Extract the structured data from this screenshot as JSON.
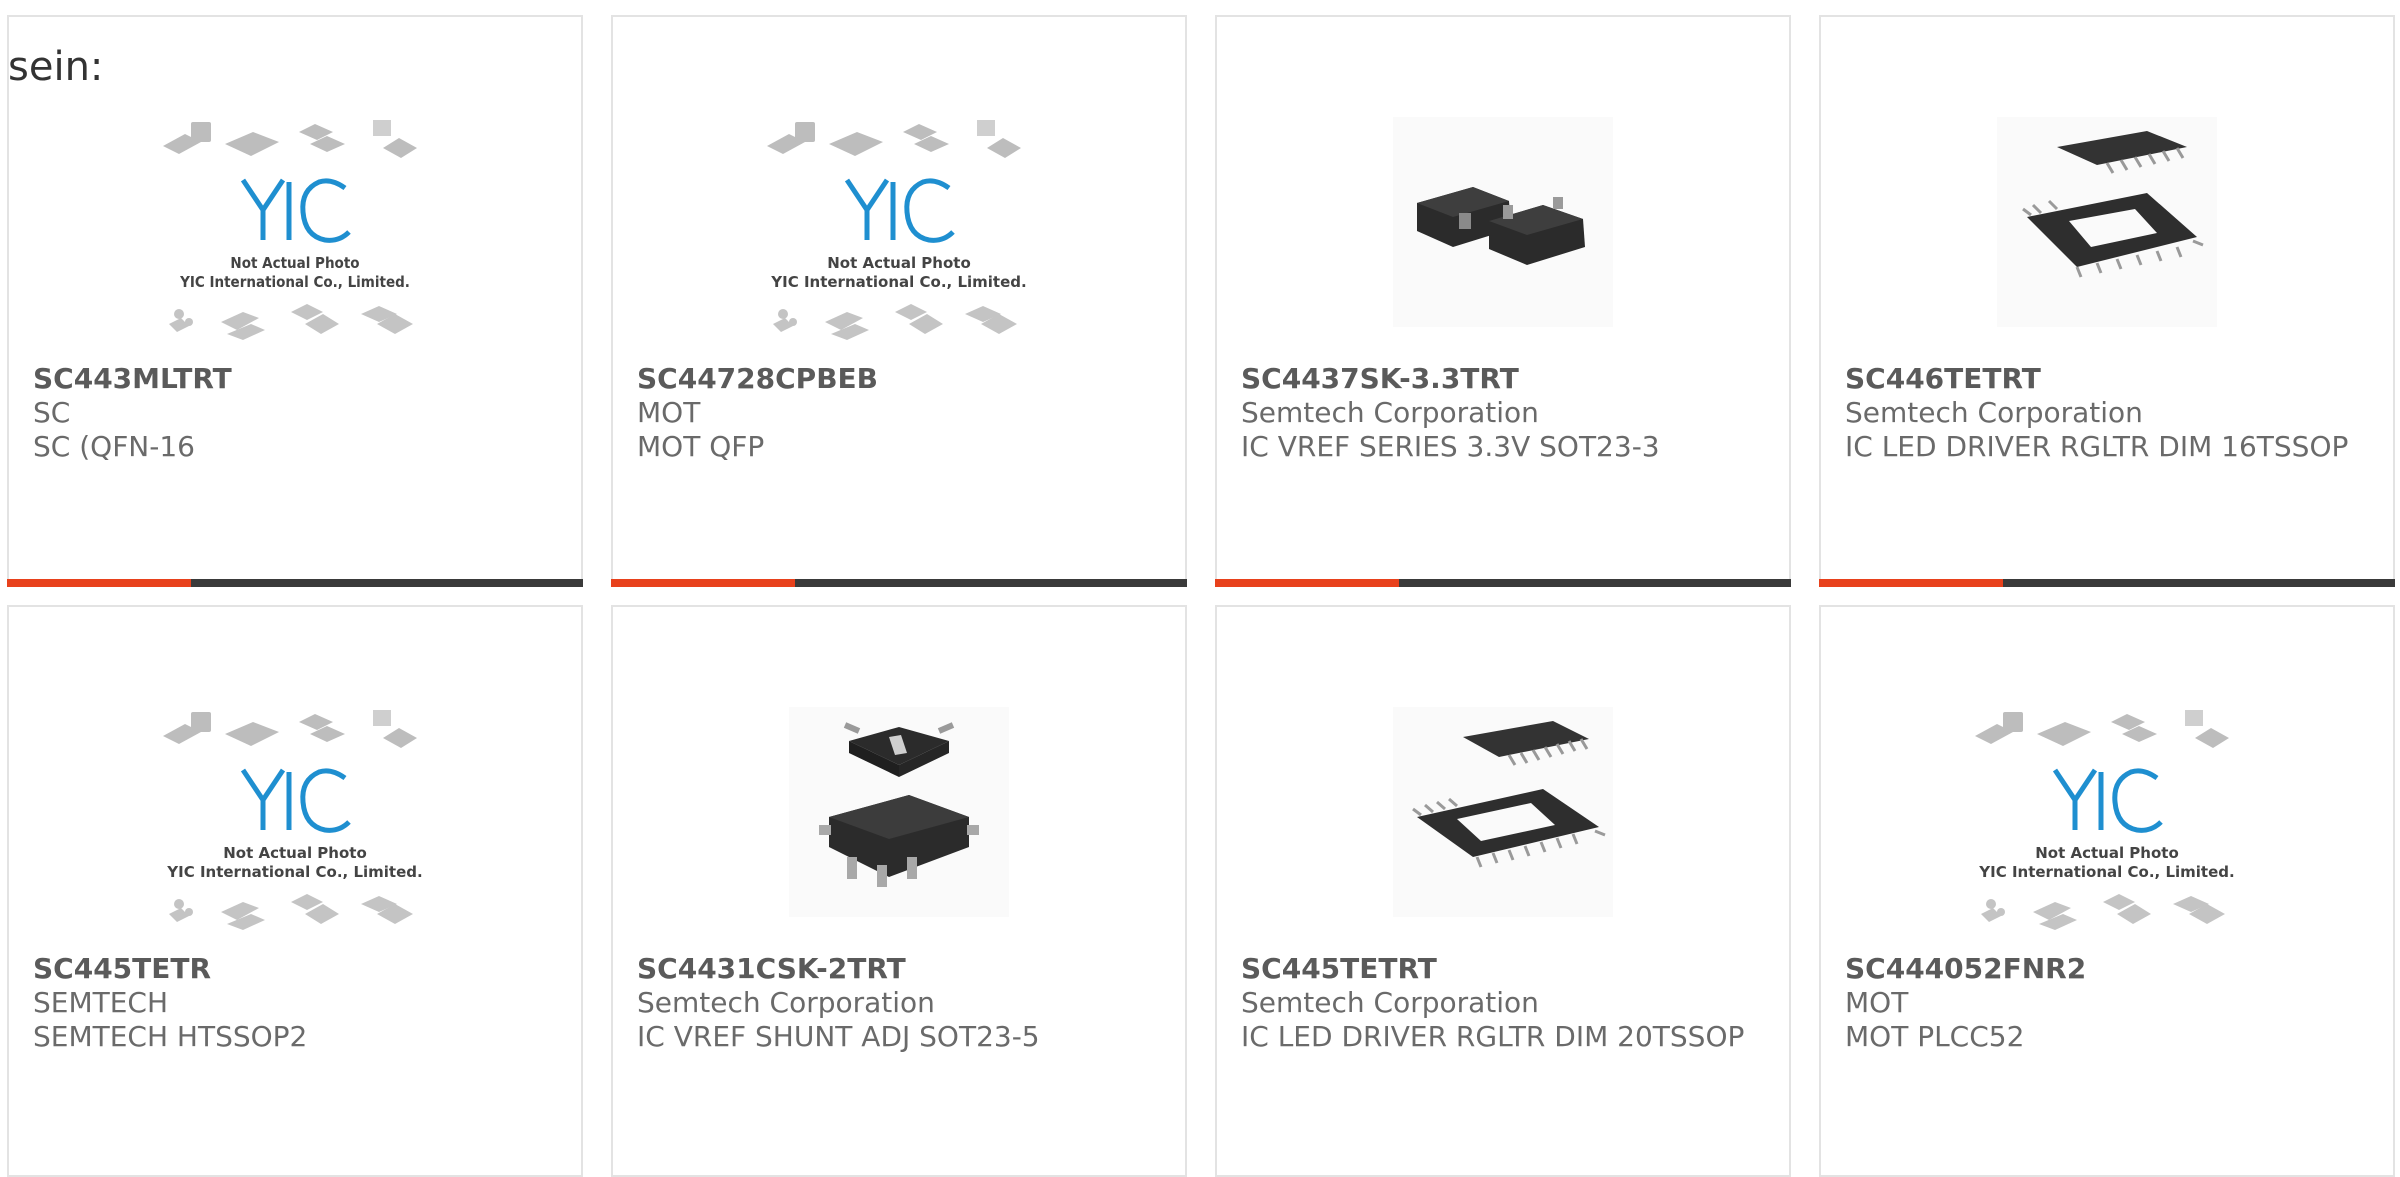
{
  "page": {
    "label": "sein:"
  },
  "products": [
    {
      "part_number": "SC443MLTRT",
      "manufacturer": "SC",
      "description": "SC (QFN-16",
      "image": "yic-placeholder"
    },
    {
      "part_number": "SC44728CPBEB",
      "manufacturer": "MOT",
      "description": "MOT QFP",
      "image": "yic-placeholder"
    },
    {
      "part_number": "SC4437SK-3.3TRT",
      "manufacturer": "Semtech Corporation",
      "description": "IC VREF SERIES 3.3V SOT23-3",
      "image": "sot23-3-package"
    },
    {
      "part_number": "SC446TETRT",
      "manufacturer": "Semtech Corporation",
      "description": "IC LED DRIVER RGLTR DIM 16TSSOP",
      "image": "tssop16-package"
    },
    {
      "part_number": "SC445TETR",
      "manufacturer": "SEMTECH",
      "description": "SEMTECH HTSSOP2",
      "image": "yic-placeholder"
    },
    {
      "part_number": "SC4431CSK-2TRT",
      "manufacturer": "Semtech Corporation",
      "description": "IC VREF SHUNT ADJ SOT23-5",
      "image": "sot23-5-package"
    },
    {
      "part_number": "SC445TETRT",
      "manufacturer": "Semtech Corporation",
      "description": "IC LED DRIVER RGLTR DIM 20TSSOP",
      "image": "tssop20-package"
    },
    {
      "part_number": "SC444052FNR2",
      "manufacturer": "MOT",
      "description": "MOT PLCC52",
      "image": "yic-placeholder"
    }
  ],
  "placeholder": {
    "logo_text": "YIC",
    "line1": "Not Actual Photo",
    "line2": "YIC International Co., Limited."
  },
  "colors": {
    "accent": "#e8411c",
    "bar": "#3a3a3a",
    "border": "#e3e3e3",
    "logo": "#1f8fd0"
  }
}
